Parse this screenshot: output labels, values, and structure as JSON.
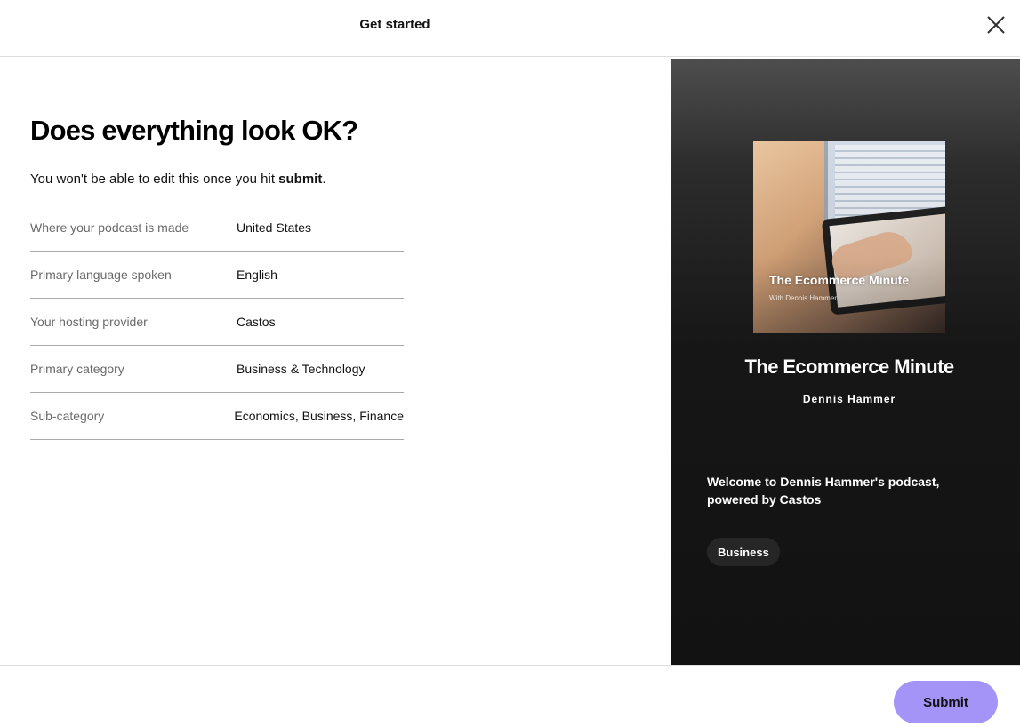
{
  "header": {
    "title": "Get started",
    "close_icon": "close-icon"
  },
  "main": {
    "heading": "Does everything look OK?",
    "subtext_prefix": "You won't be able to edit this once you hit ",
    "subtext_bold": "submit",
    "subtext_suffix": ".",
    "details": [
      {
        "label": "Where your podcast is made",
        "value": "United States"
      },
      {
        "label": "Primary language spoken",
        "value": "English"
      },
      {
        "label": "Your hosting provider",
        "value": "Castos"
      },
      {
        "label": "Primary category",
        "value": "Business & Technology"
      },
      {
        "label": "Sub-category",
        "value": "Economics, Business, Finance"
      }
    ]
  },
  "preview": {
    "cover_title": "The Ecommerce Minute",
    "cover_subtitle": "With Dennis Hammer",
    "title": "The Ecommerce Minute",
    "author": "Dennis Hammer",
    "description": "Welcome to Dennis Hammer's podcast, powered by Castos",
    "category_chip": "Business"
  },
  "footer": {
    "submit_label": "Submit"
  },
  "colors": {
    "accent": "#a494f8",
    "preview_bg": "#121212",
    "chip_bg": "#262626"
  }
}
